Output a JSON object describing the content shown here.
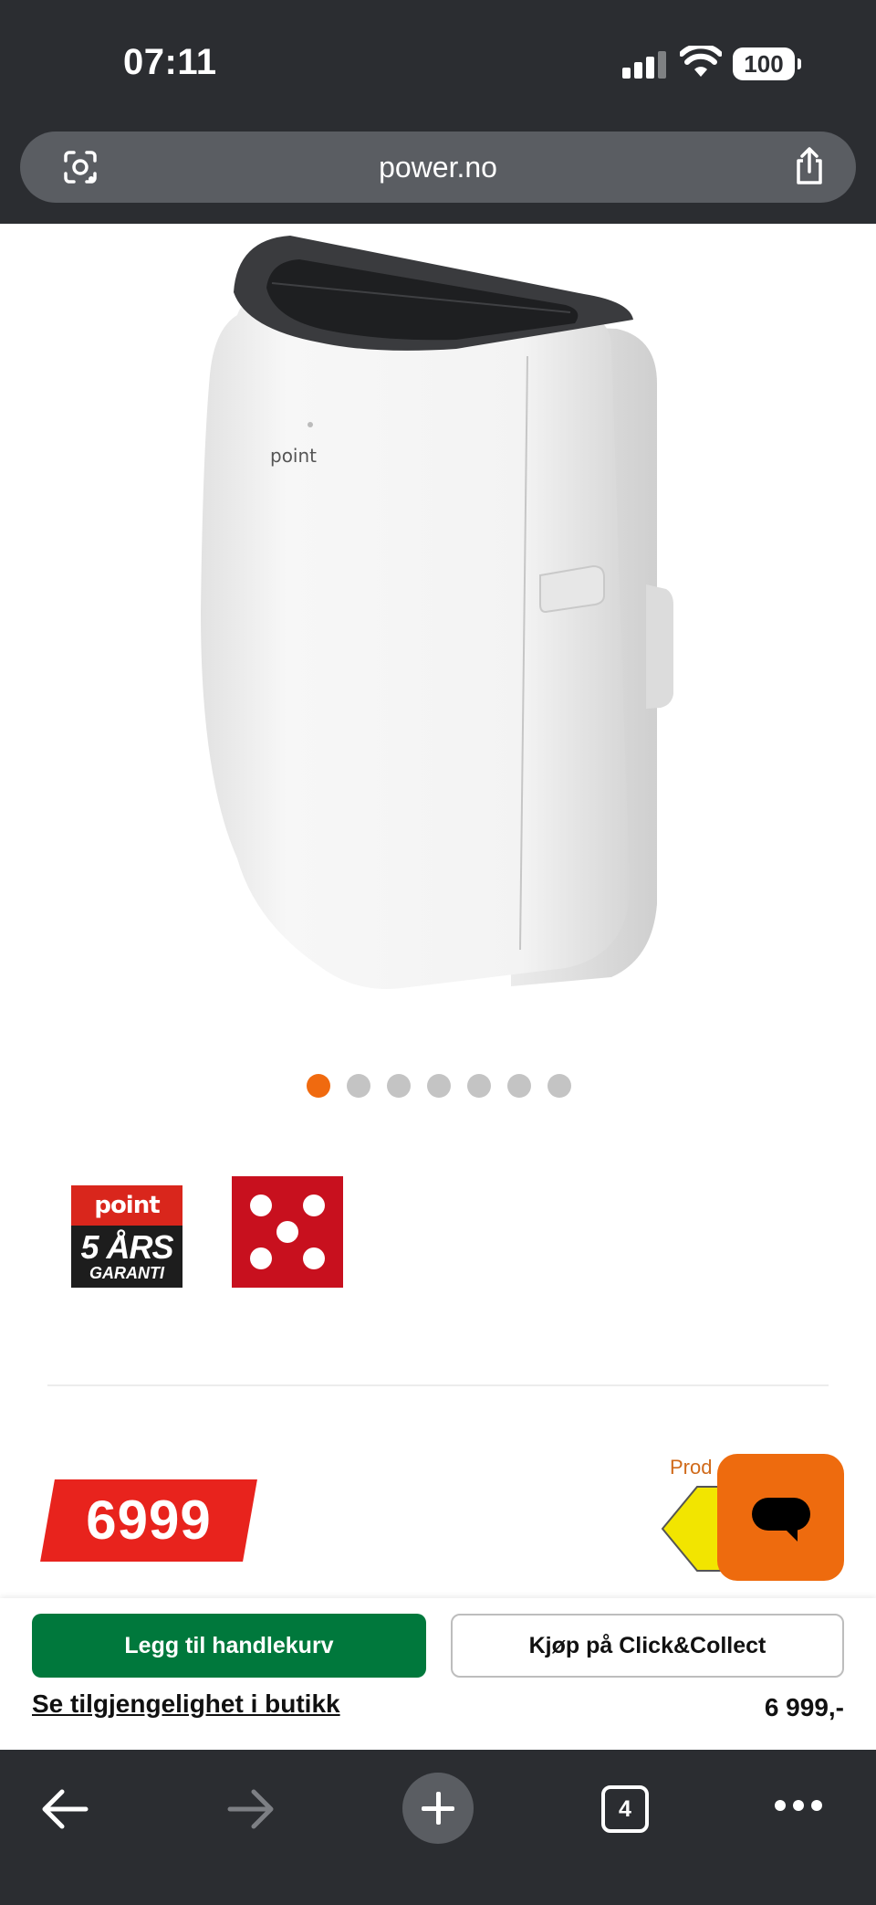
{
  "status_bar": {
    "time": "07:11",
    "battery": "100",
    "icons": [
      "signal-icon",
      "wifi-icon",
      "battery-icon"
    ]
  },
  "address_bar": {
    "url": "power.no",
    "icons": [
      "google-lens-icon",
      "share-icon"
    ]
  },
  "product": {
    "image_logo": "point",
    "carousel": {
      "count": 7,
      "active_index": 0
    },
    "badges": {
      "warranty_brand": "point",
      "warranty_years": "5 ÅRS",
      "warranty_word": "GARANTI"
    },
    "price": "6999",
    "energy_label_text": "Prod"
  },
  "action_bar": {
    "add_to_cart": "Legg til handlekurv",
    "click_collect": "Kjøp på Click&Collect",
    "store_availability": "Se tilgjengelighet i butikk",
    "price": "6 999,-"
  },
  "browser_toolbar": {
    "tab_count": "4",
    "icons": [
      "back-icon",
      "forward-icon",
      "new-tab-icon",
      "tabs-icon",
      "more-icon"
    ]
  },
  "colors": {
    "chrome_dark": "#2b2d31",
    "accent_orange": "#ee6b0e",
    "price_red": "#e8231d",
    "cart_green": "#00783c"
  }
}
